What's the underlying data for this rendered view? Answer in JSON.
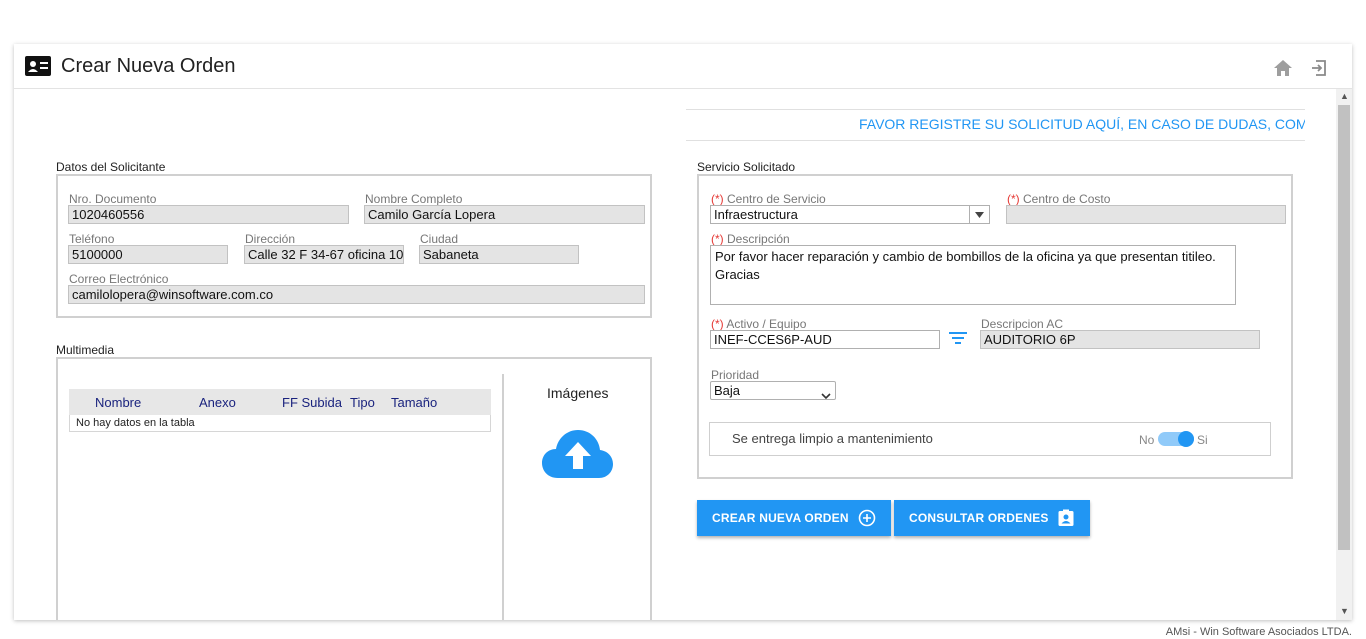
{
  "header": {
    "title": "Crear Nueva Orden",
    "icons": [
      "id-card-icon",
      "home-icon",
      "exit-icon"
    ]
  },
  "banner": {
    "text": "FAVOR REGISTRE SU SOLICITUD AQUÍ, EN CASO DE DUDAS, COMUNICA"
  },
  "solicitante": {
    "title": "Datos del Solicitante",
    "nro_documento": {
      "label": "Nro. Documento",
      "value": "1020460556"
    },
    "nombre_completo": {
      "label": "Nombre Completo",
      "value": "Camilo García Lopera"
    },
    "telefono": {
      "label": "Teléfono",
      "value": "5100000"
    },
    "direccion": {
      "label": "Dirección",
      "value": "Calle 32 F 34-67 oficina 10"
    },
    "ciudad": {
      "label": "Ciudad",
      "value": "Sabaneta"
    },
    "correo": {
      "label": "Correo Electrónico",
      "value": "camilolopera@winsoftware.com.co"
    }
  },
  "multimedia": {
    "title": "Multimedia",
    "columns": [
      "Nombre",
      "Anexo",
      "FF Subida",
      "Tipo",
      "Tamaño"
    ],
    "empty": "No hay datos en la tabla",
    "images_label": "Imágenes"
  },
  "servicio": {
    "title": "Servicio Solicitado",
    "required_mark": "(*)",
    "centro_servicio": {
      "label": "Centro de Servicio",
      "value": "Infraestructura"
    },
    "centro_costo": {
      "label": "Centro de Costo",
      "value": ""
    },
    "descripcion": {
      "label": "Descripción",
      "line1": "Por favor hacer reparación y cambio de bombillos de la oficina ya que presentan titileo.",
      "line2": "Gracias"
    },
    "activo": {
      "label": "Activo / Equipo",
      "value": "INEF-CCES6P-AUD"
    },
    "descripcion_ac": {
      "label": "Descripcion AC",
      "value": "AUDITORIO 6P"
    },
    "prioridad": {
      "label": "Prioridad",
      "value": "Baja"
    },
    "limpio": {
      "label": "Se entrega limpio a mantenimiento",
      "no": "No",
      "si": "Si",
      "checked": true
    }
  },
  "buttons": {
    "crear": "CREAR NUEVA ORDEN",
    "consultar": "CONSULTAR ORDENES"
  },
  "colors": {
    "accent": "#2196f3",
    "required": "#e53935"
  },
  "footer": "AMsi - Win Software Asociados LTDA."
}
